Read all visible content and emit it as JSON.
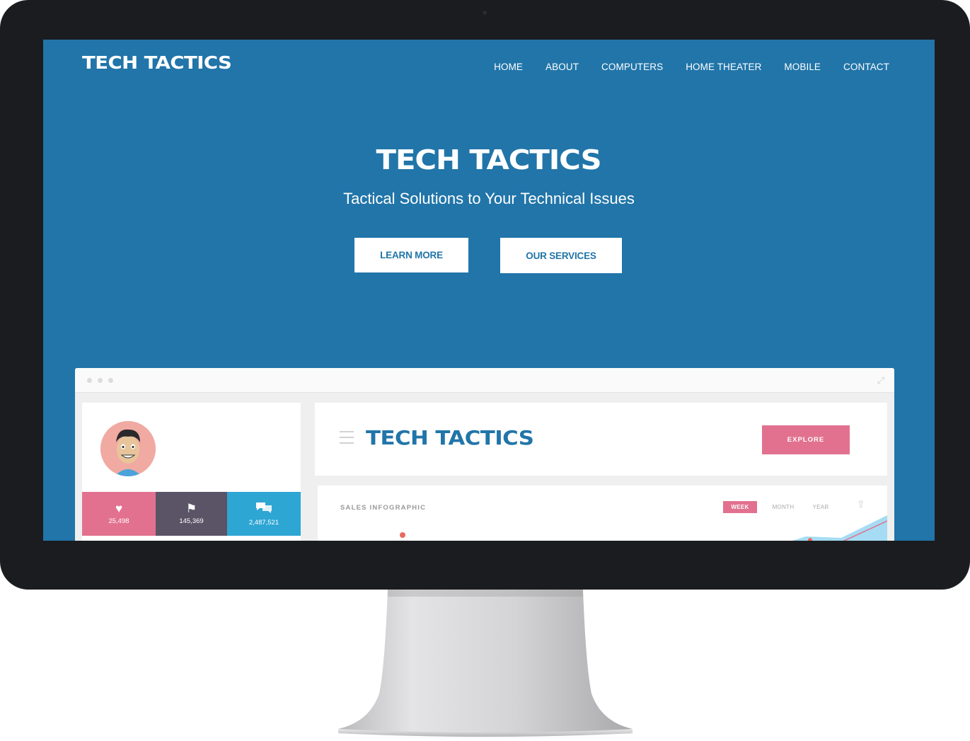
{
  "site": {
    "logo": "TECH TACTICS",
    "nav": [
      "HOME",
      "ABOUT",
      "COMPUTERS",
      "HOME THEATER",
      "MOBILE",
      "CONTACT"
    ]
  },
  "hero": {
    "title": "TECH TACTICS",
    "subtitle": "Tactical Solutions to Your Technical Issues",
    "buttons": {
      "learn_more": "LEARN MORE",
      "our_services": "OUR SERVICES"
    }
  },
  "dashboard": {
    "brand": "TECH TACTICS",
    "explore_label": "EXPLORE",
    "stats": [
      {
        "icon": "heart-icon",
        "value": "25,498",
        "color": "#e2718f"
      },
      {
        "icon": "flag-icon",
        "value": "145,369",
        "color": "#5b5466"
      },
      {
        "icon": "chat-icon",
        "value": "2,487,521",
        "color": "#2ea6d4"
      }
    ],
    "sales": {
      "title": "SALES INFOGRAPHIC",
      "periods": [
        "WEEK",
        "MONTH",
        "YEAR"
      ],
      "active_period": "WEEK"
    }
  },
  "colors": {
    "brand_blue": "#2175a9",
    "accent_pink": "#e2718f",
    "bezel": "#1b1c1f"
  }
}
